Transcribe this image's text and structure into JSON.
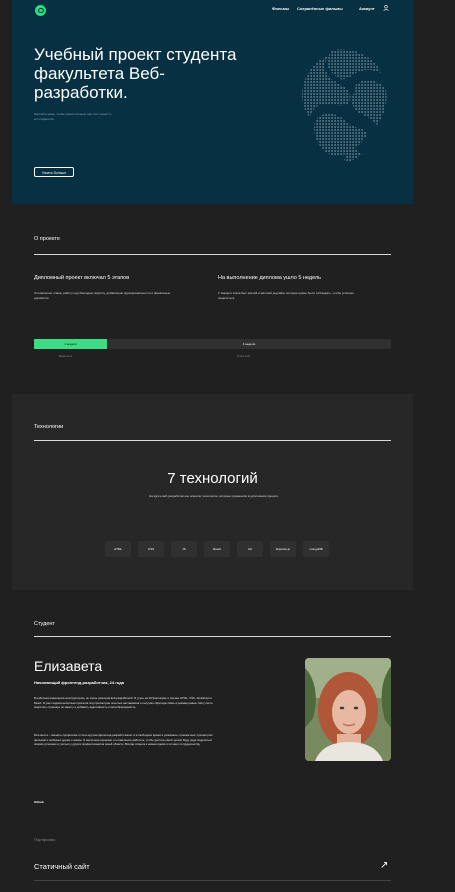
{
  "header": {
    "nav_films": "Фильмы",
    "nav_saved": "Сохранённые фильмы",
    "nav_account": "Аккаунт"
  },
  "hero": {
    "title": "Учебный проект студента факультета Веб-разработки.",
    "subtitle": "Листайте ниже, чтобы узнать больше про этот проект и его создателя.",
    "button": "Узнать больше"
  },
  "about": {
    "title": "О проекте",
    "col1_heading": "Дипломный проект включал 5 этапов",
    "col1_text": "Составление плана, работу над бэкендом, вёрстку, добавление функциональности и финальные доработки.",
    "col2_heading": "На выполнение диплома ушло 5 недель",
    "col2_text": "У каждого этапа был мягкий и жёсткий дедлайн, которые нужно было соблюдать, чтобы успешно защититься.",
    "bar_left": "1 неделя",
    "bar_right": "4 недели",
    "label_left": "Back-end",
    "label_right": "Front-end"
  },
  "tech": {
    "title": "Технологии",
    "headline": "7 технологий",
    "text": "На курсе веб-разработки мы освоили технологии, которые применили в дипломном проекте.",
    "chips": [
      "HTML",
      "CSS",
      "JS",
      "React",
      "Git",
      "Express.js",
      "mongoDB"
    ]
  },
  "student": {
    "title": "Студент",
    "name": "Елизавета",
    "job": "Начинающий фронтенд-разработчик, 24 года",
    "bio1": "В работала инженером-конструктором, но очень увлечена веб-разработкой. Я учусь на Я.Практикуме и изучаю HTML, CSS, JavaScript и React. Я уже создала несколько проектов под присмотром опытных наставников и получаю обратную связь в режиме ревью. Могу легко сверстать страницы по макету и добавить адаптивность и кроссбраузерность.",
    "bio2": "Моя мечта – сменить профессию и стать крутым фронтенд-разработчиком. А в свободное время я увлекаюсь чтением книг, просмотром фильмов и любимых дорам и аниме. Я настроена серьёзно и готова много работать, чтобы достичь своих целей. Буду рада поделиться своими успехами и учиться у других профессионалов своей области. Всегда открыта к новым идеям и готова к сотрудничеству.",
    "github": "Github"
  },
  "portfolio": {
    "label": "Портфолио",
    "item": "Статичный сайт",
    "arrow": "↗"
  },
  "colors": {
    "hero_bg": "#073042",
    "accent": "#3ddc84",
    "page_bg": "#202020"
  },
  "icons": [
    "logo-icon",
    "account-icon",
    "arrow-icon"
  ]
}
